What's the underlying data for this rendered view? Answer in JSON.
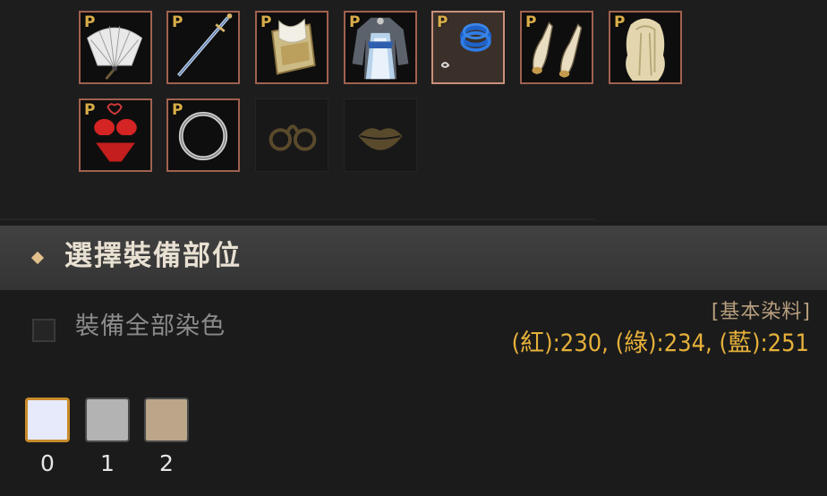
{
  "equipment": {
    "slots": [
      {
        "id": "fan",
        "badge": "P",
        "icon": "fan-icon",
        "state": "equipped"
      },
      {
        "id": "sword",
        "badge": "P",
        "icon": "sword-icon",
        "state": "equipped"
      },
      {
        "id": "armor",
        "badge": "P",
        "icon": "armor-icon",
        "state": "equipped"
      },
      {
        "id": "outfit",
        "badge": "P",
        "icon": "outfit-icon",
        "state": "equipped"
      },
      {
        "id": "bracelet",
        "badge": "P",
        "icon": "bracelet-icon",
        "state": "selected"
      },
      {
        "id": "shoes",
        "badge": "P",
        "icon": "shoes-icon",
        "state": "equipped"
      },
      {
        "id": "wig",
        "badge": "P",
        "icon": "wig-icon",
        "state": "equipped"
      },
      {
        "id": "underwear",
        "badge": "P",
        "icon": "underwear-icon",
        "state": "equipped"
      },
      {
        "id": "ring",
        "badge": "P",
        "icon": "ring-icon",
        "state": "equipped"
      },
      {
        "id": "glasses",
        "badge": "",
        "icon": "glasses-icon",
        "state": "empty"
      },
      {
        "id": "lips",
        "badge": "",
        "icon": "lips-icon",
        "state": "empty"
      }
    ]
  },
  "section": {
    "title": "選擇裝備部位"
  },
  "dye": {
    "dye_all_label": "裝備全部染色",
    "dye_all_checked": false,
    "dye_type": "[基本染料]",
    "rgb_text": "(紅):230, (綠):234, (藍):251",
    "accent_color": "#e6b13a"
  },
  "palette": {
    "swatches": [
      {
        "index": "0",
        "color": "#e6eafb",
        "selected": true
      },
      {
        "index": "1",
        "color": "#b3b3b3",
        "selected": false
      },
      {
        "index": "2",
        "color": "#bba68a",
        "selected": false
      }
    ]
  }
}
